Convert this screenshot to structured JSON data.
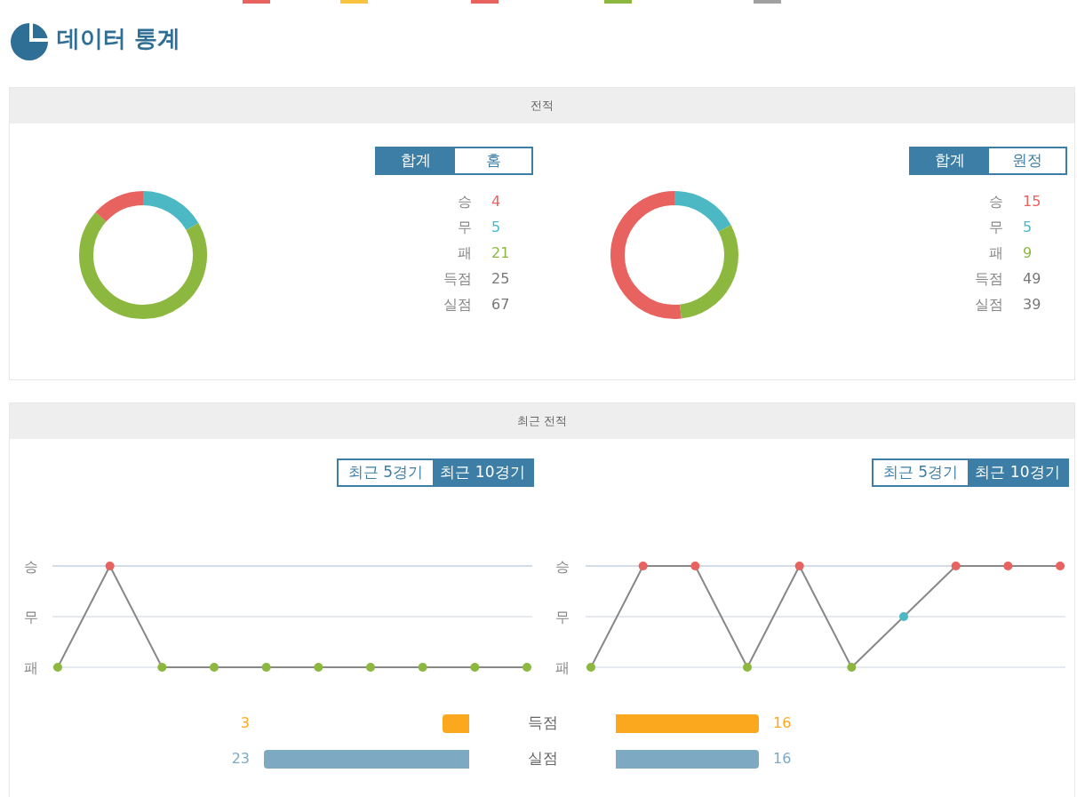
{
  "legend": [
    {
      "color": "#e8625f"
    },
    {
      "color": "#f8c33f"
    },
    {
      "color": "#e8625f"
    },
    {
      "color": "#8db83f"
    },
    {
      "color": "#a0a0a0"
    }
  ],
  "title": "데이터 통계",
  "record": {
    "header": "전적",
    "panels": [
      {
        "tabs": [
          {
            "label": "합계",
            "selected": true
          },
          {
            "label": "홈",
            "selected": false
          }
        ],
        "stats": [
          {
            "kind": "win",
            "label": "승",
            "value": "4"
          },
          {
            "kind": "draw",
            "label": "무",
            "value": "5"
          },
          {
            "kind": "loss",
            "label": "패",
            "value": "21"
          },
          {
            "kind": "scored",
            "label": "득점",
            "value": "25"
          },
          {
            "kind": "conceded",
            "label": "실점",
            "value": "67"
          }
        ]
      },
      {
        "tabs": [
          {
            "label": "합계",
            "selected": true
          },
          {
            "label": "원정",
            "selected": false
          }
        ],
        "stats": [
          {
            "kind": "win",
            "label": "승",
            "value": "15"
          },
          {
            "kind": "draw",
            "label": "무",
            "value": "5"
          },
          {
            "kind": "loss",
            "label": "패",
            "value": "9"
          },
          {
            "kind": "scored",
            "label": "득점",
            "value": "49"
          },
          {
            "kind": "conceded",
            "label": "실점",
            "value": "39"
          }
        ]
      }
    ]
  },
  "recent": {
    "header": "최근 전적",
    "panels": [
      {
        "tabs": [
          {
            "label": "최근 5경기",
            "selected": false
          },
          {
            "label": "최근 10경기",
            "selected": true
          }
        ],
        "axis_labels": [
          "승",
          "무",
          "패"
        ],
        "results": [
          {
            "kind": "loss"
          },
          {
            "kind": "win"
          },
          {
            "kind": "loss"
          },
          {
            "kind": "loss"
          },
          {
            "kind": "loss"
          },
          {
            "kind": "loss"
          },
          {
            "kind": "loss"
          },
          {
            "kind": "loss"
          },
          {
            "kind": "loss"
          },
          {
            "kind": "loss"
          }
        ]
      },
      {
        "tabs": [
          {
            "label": "최근 5경기",
            "selected": false
          },
          {
            "label": "최근 10경기",
            "selected": true
          }
        ],
        "axis_labels": [
          "승",
          "무",
          "패"
        ],
        "results": [
          {
            "kind": "loss"
          },
          {
            "kind": "win"
          },
          {
            "kind": "win"
          },
          {
            "kind": "loss"
          },
          {
            "kind": "win"
          },
          {
            "kind": "loss"
          },
          {
            "kind": "draw"
          },
          {
            "kind": "win"
          },
          {
            "kind": "win"
          },
          {
            "kind": "win"
          }
        ]
      }
    ],
    "comparison": [
      {
        "kind": "scored",
        "label": "득점",
        "left": {
          "value": "3"
        },
        "right": {
          "value": "16"
        }
      },
      {
        "kind": "conceded",
        "label": "실점",
        "left": {
          "value": "23"
        },
        "right": {
          "value": "16"
        }
      }
    ]
  }
}
